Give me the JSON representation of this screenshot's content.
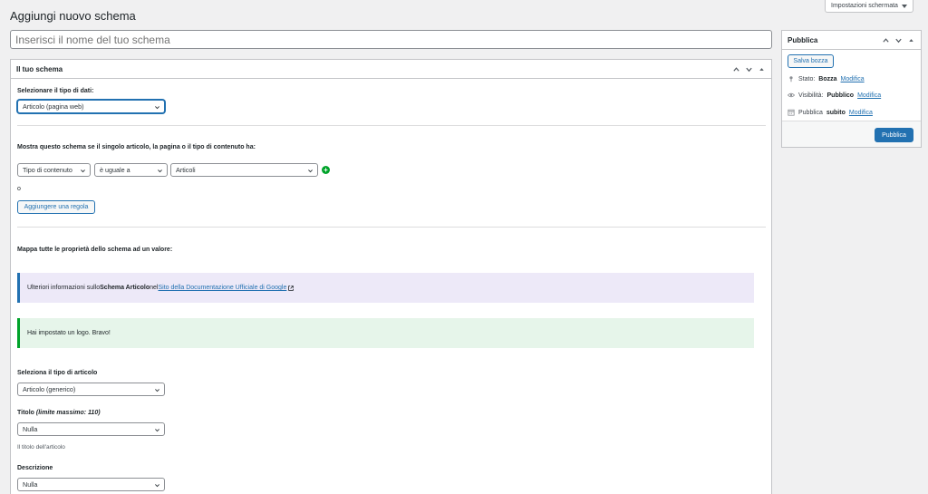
{
  "header": {
    "screen_options_label": "Impostazioni schermata",
    "page_title": "Aggiungi nuovo schema",
    "title_placeholder": "Inserisci il nome del tuo schema"
  },
  "schema_box": {
    "title": "Il tuo schema",
    "data_type_label": "Selezionare il tipo di dati:",
    "data_type_value": "Articolo (pagina web)",
    "condition_label": "Mostra questo schema se il singolo articolo, la pagina o il tipo di contenuto ha:",
    "rule": {
      "param": "Tipo di contenuto",
      "operator": "è uguale a",
      "value": "Articoli"
    },
    "or_label": "o",
    "add_rule_button": "Aggiungere una regola",
    "map_label": "Mappa tutte le proprietà dello schema ad un valore:",
    "info_notice": {
      "prefix": "Ulteriori informazioni sullo ",
      "strong": "Schema Articolo",
      "middle": " nel ",
      "link": "Sito della Documentazione Ufficiale di Google"
    },
    "success_notice": "Hai impostato un logo. Bravo!",
    "article_type_label": "Seleziona il tipo di articolo",
    "article_type_value": "Articolo (generico)",
    "title_field_label": "Titolo",
    "title_field_hint": "(limite massimo: 110)",
    "title_field_value": "Nulla",
    "title_field_desc": "Il titolo dell'articolo",
    "description_label": "Descrizione",
    "description_value": "Nulla"
  },
  "publish_box": {
    "title": "Pubblica",
    "save_draft_button": "Salva bozza",
    "status_label": "Stato:",
    "status_value": "Bozza",
    "visibility_label": "Visibilità:",
    "visibility_value": "Pubblico",
    "publish_when": "Pubblica",
    "publish_when_value": "subito",
    "edit_link": "Modifica",
    "publish_button": "Pubblica"
  },
  "colors": {
    "accent": "#2271b1",
    "success": "#00a32a",
    "background": "#f0f0f1"
  }
}
